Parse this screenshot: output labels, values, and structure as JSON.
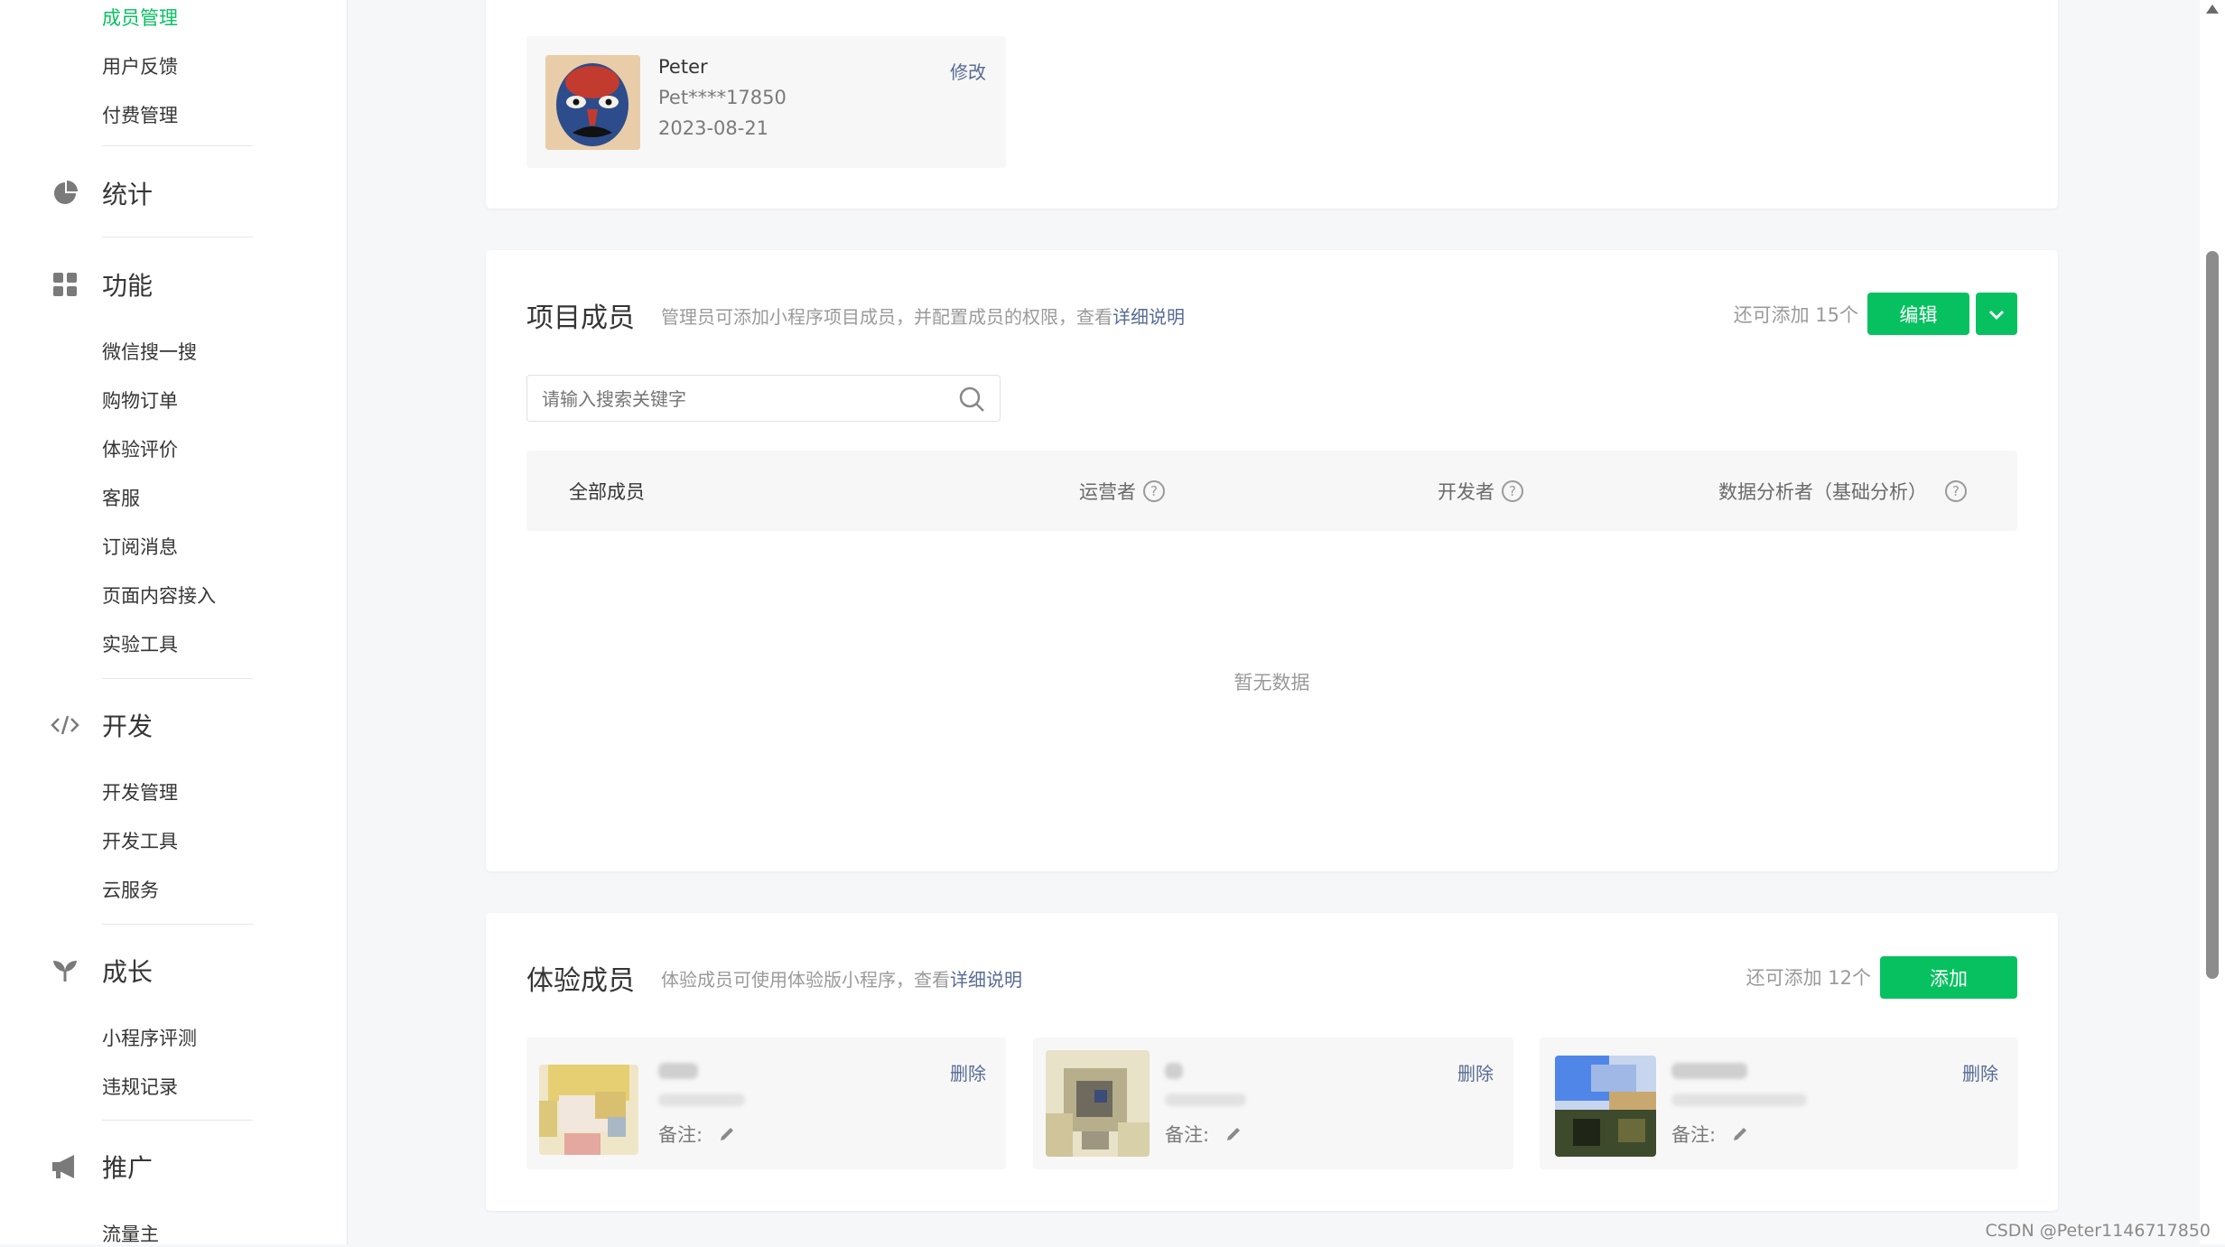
{
  "sidebar": {
    "items_top": [
      "成员管理",
      "用户反馈",
      "付费管理"
    ],
    "sections": [
      {
        "label": "统计",
        "icon": "pie-chart-icon",
        "items": []
      },
      {
        "label": "功能",
        "icon": "grid-icon",
        "items": [
          "微信搜一搜",
          "购物订单",
          "体验评价",
          "客服",
          "订阅消息",
          "页面内容接入",
          "实验工具"
        ]
      },
      {
        "label": "开发",
        "icon": "code-icon",
        "items": [
          "开发管理",
          "开发工具",
          "云服务"
        ]
      },
      {
        "label": "成长",
        "icon": "sprout-icon",
        "items": [
          "小程序评测",
          "违规记录"
        ]
      },
      {
        "label": "推广",
        "icon": "megaphone-icon",
        "items": [
          "流量主"
        ]
      }
    ]
  },
  "admin": {
    "name": "Peter",
    "account": "Pet****17850",
    "date": "2023-08-21",
    "edit_label": "修改",
    "avatar_icon": "opera-mask-avatar"
  },
  "project_members": {
    "title": "项目成员",
    "desc_prefix": "管理员可添加小程序项目成员，并配置成员的权限，查看",
    "desc_link": "详细说明",
    "quota": "还可添加 15个",
    "edit_button": "编辑",
    "search_placeholder": "请输入搜索关键字",
    "columns": [
      "全部成员",
      "运营者",
      "开发者",
      "数据分析者（基础分析）"
    ],
    "empty_text": "暂无数据"
  },
  "trial_members": {
    "title": "体验成员",
    "desc_prefix": "体验成员可使用体验版小程序，查看",
    "desc_link": "详细说明",
    "quota": "还可添加 12个",
    "add_button": "添加",
    "members": [
      {
        "delete_label": "删除",
        "note_label": "备注:"
      },
      {
        "delete_label": "删除",
        "note_label": "备注:"
      },
      {
        "delete_label": "删除",
        "note_label": "备注:"
      }
    ]
  },
  "watermark": "CSDN @Peter1146717850",
  "colors": {
    "accent": "#07c160",
    "link": "#576b95",
    "text": "#353535",
    "muted": "#9a9a9a"
  }
}
